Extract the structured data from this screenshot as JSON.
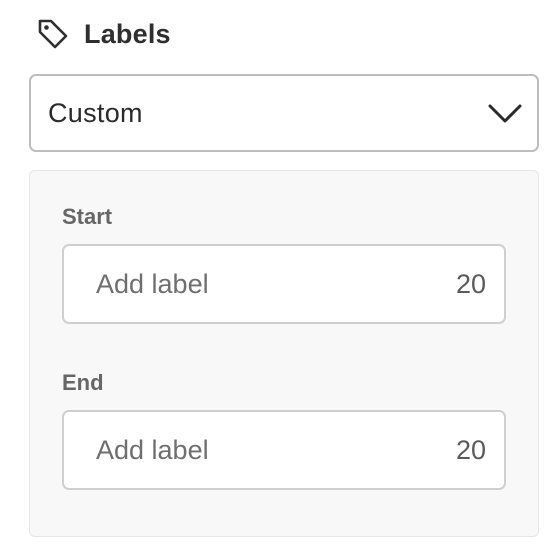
{
  "header": {
    "icon": "tag-icon",
    "title": "Labels"
  },
  "label_mode": {
    "selected": "Custom",
    "icon": "chevron-down-icon"
  },
  "custom_labels": {
    "start": {
      "label": "Start",
      "placeholder": "Add label",
      "value": "",
      "remaining": "20"
    },
    "end": {
      "label": "End",
      "placeholder": "Add label",
      "value": "",
      "remaining": "20"
    }
  },
  "colors": {
    "text": "#2b2b2b",
    "border": "#bdbdbd",
    "panel_bg": "#f8f8f8",
    "muted_label": "#666666"
  }
}
